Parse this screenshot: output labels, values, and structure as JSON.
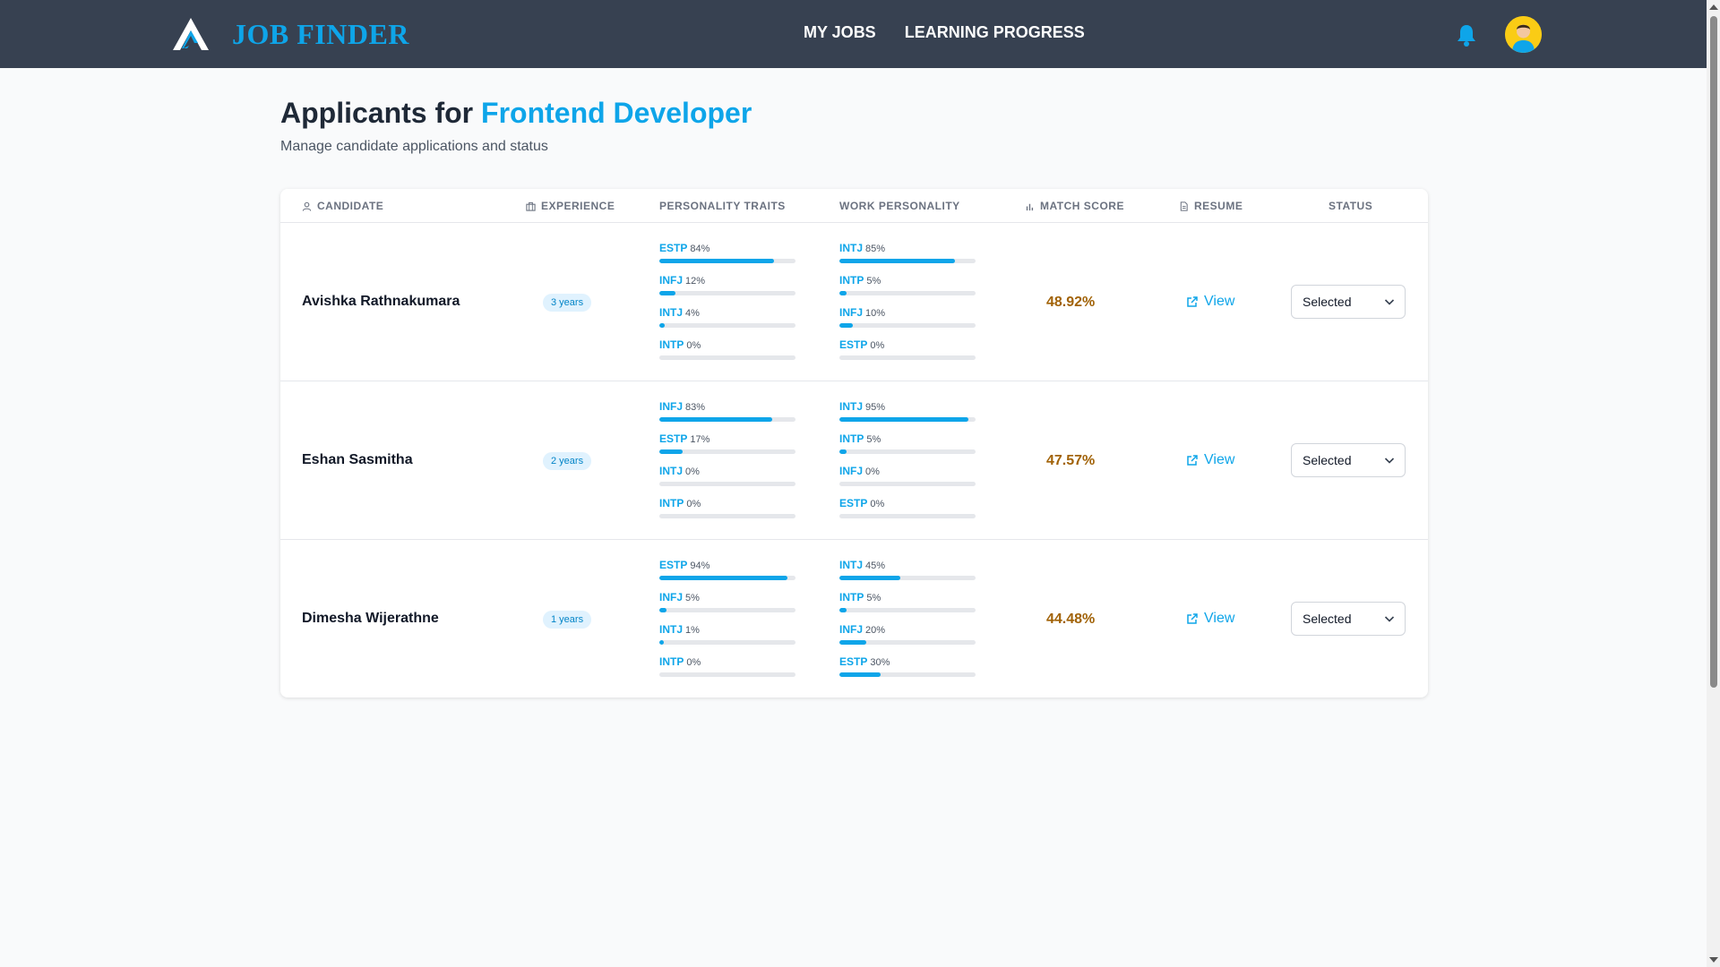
{
  "brand": {
    "name": "JOB FINDER",
    "logo_icon": "mountain-logo-icon",
    "accent_color": "#0ea5e9",
    "nav_bg": "#374151"
  },
  "nav": {
    "links": [
      "MY JOBS",
      "LEARNING PROGRESS"
    ],
    "bell_icon": "bell-icon",
    "avatar_icon": "user-avatar"
  },
  "header": {
    "title_prefix": "Applicants for",
    "job_title": "Frontend Developer",
    "subtitle": "Manage candidate applications and status"
  },
  "table": {
    "columns": {
      "candidate": "CANDIDATE",
      "experience": "EXPERIENCE",
      "personality_traits": "PERSONALITY TRAITS",
      "work_personality": "WORK PERSONALITY",
      "match_score": "MATCH SCORE",
      "resume": "RESUME",
      "status": "STATUS"
    },
    "resume_link_label": "View",
    "rows": [
      {
        "name": "Avishka Rathnakumara",
        "experience": "3 years",
        "personality": [
          {
            "type": "ESTP",
            "pct": "84%",
            "value": 84
          },
          {
            "type": "INFJ",
            "pct": "12%",
            "value": 12
          },
          {
            "type": "INTJ",
            "pct": "4%",
            "value": 4
          },
          {
            "type": "INTP",
            "pct": "0%",
            "value": 0
          }
        ],
        "work": [
          {
            "type": "INTJ",
            "pct": "85%",
            "value": 85
          },
          {
            "type": "INTP",
            "pct": "5%",
            "value": 5
          },
          {
            "type": "INFJ",
            "pct": "10%",
            "value": 10
          },
          {
            "type": "ESTP",
            "pct": "0%",
            "value": 0
          }
        ],
        "match_score": "48.92%",
        "status": "Selected"
      },
      {
        "name": "Eshan Sasmitha",
        "experience": "2 years",
        "personality": [
          {
            "type": "INFJ",
            "pct": "83%",
            "value": 83
          },
          {
            "type": "ESTP",
            "pct": "17%",
            "value": 17
          },
          {
            "type": "INTJ",
            "pct": "0%",
            "value": 0
          },
          {
            "type": "INTP",
            "pct": "0%",
            "value": 0
          }
        ],
        "work": [
          {
            "type": "INTJ",
            "pct": "95%",
            "value": 95
          },
          {
            "type": "INTP",
            "pct": "5%",
            "value": 5
          },
          {
            "type": "INFJ",
            "pct": "0%",
            "value": 0
          },
          {
            "type": "ESTP",
            "pct": "0%",
            "value": 0
          }
        ],
        "match_score": "47.57%",
        "status": "Selected"
      },
      {
        "name": "Dimesha Wijerathne",
        "experience": "1 years",
        "personality": [
          {
            "type": "ESTP",
            "pct": "94%",
            "value": 94
          },
          {
            "type": "INFJ",
            "pct": "5%",
            "value": 5
          },
          {
            "type": "INTJ",
            "pct": "1%",
            "value": 1
          },
          {
            "type": "INTP",
            "pct": "0%",
            "value": 0
          }
        ],
        "work": [
          {
            "type": "INTJ",
            "pct": "45%",
            "value": 45
          },
          {
            "type": "INTP",
            "pct": "5%",
            "value": 5
          },
          {
            "type": "INFJ",
            "pct": "20%",
            "value": 20
          },
          {
            "type": "ESTP",
            "pct": "30%",
            "value": 30
          }
        ],
        "match_score": "44.48%",
        "status": "Selected"
      }
    ]
  }
}
